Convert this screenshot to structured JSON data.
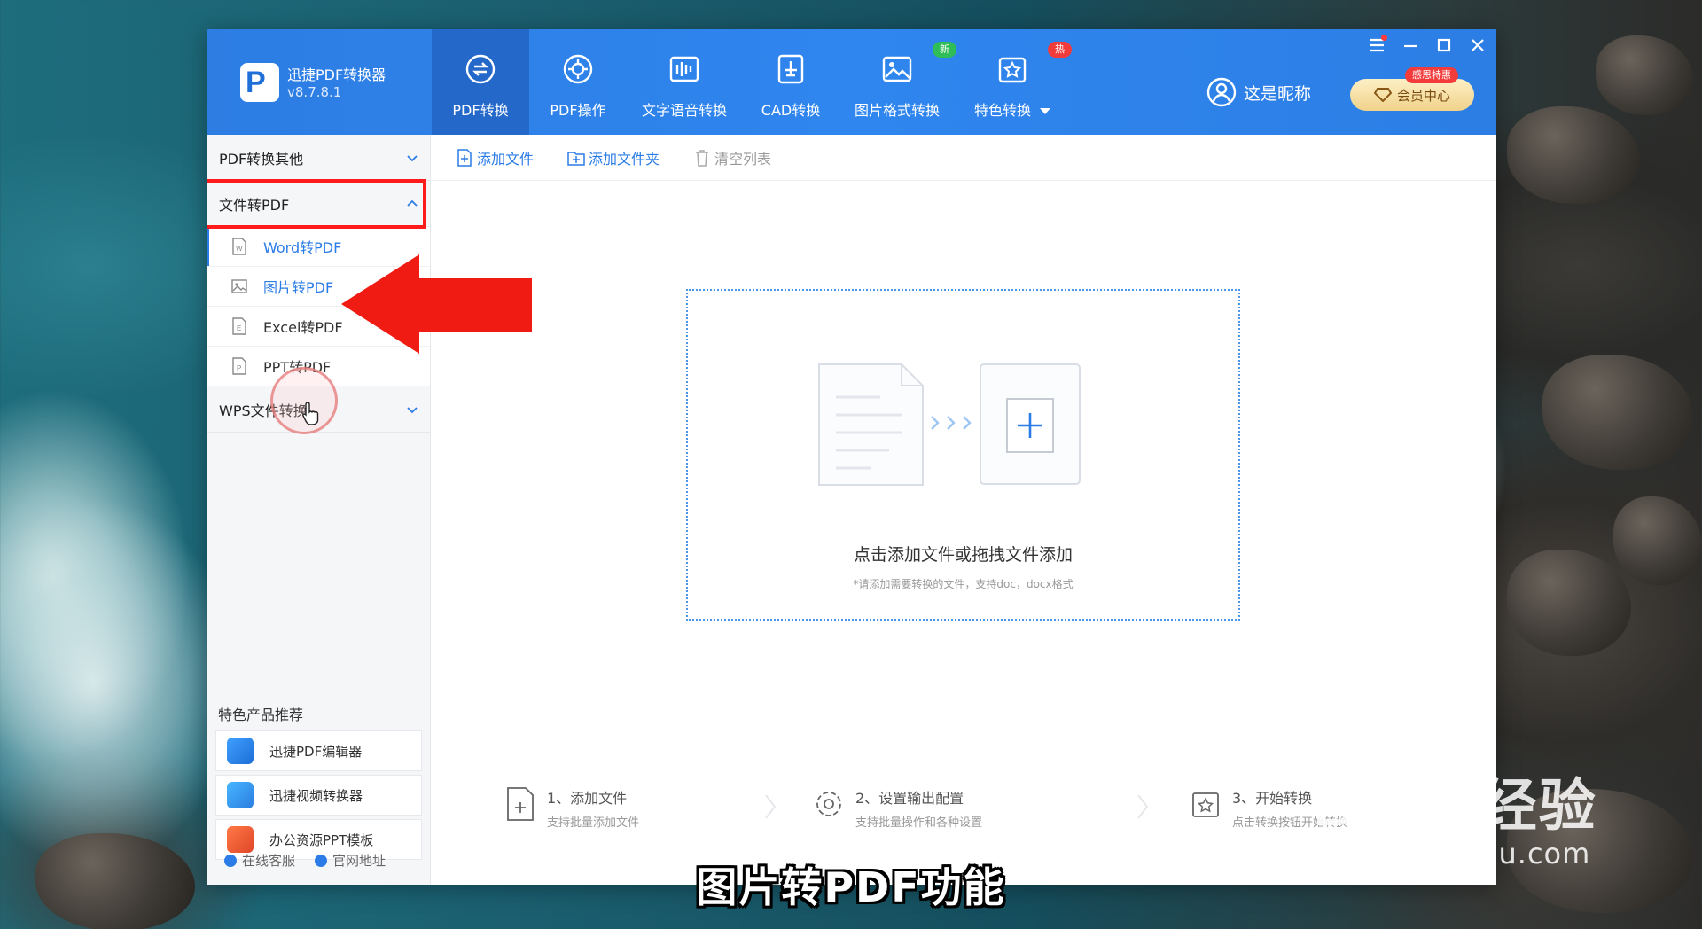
{
  "app": {
    "name": "迅捷PDF转换器",
    "version": "v8.7.8.1"
  },
  "topnav": [
    {
      "label": "PDF转换",
      "icon": "pdf-convert-icon",
      "active": true
    },
    {
      "label": "PDF操作",
      "icon": "pdf-operate-icon"
    },
    {
      "label": "文字语音转换",
      "icon": "audio-wave-icon"
    },
    {
      "label": "CAD转换",
      "icon": "cad-icon"
    },
    {
      "label": "图片格式转换",
      "icon": "image-icon",
      "badge": "新"
    },
    {
      "label": "特色转换",
      "icon": "star-convert-icon",
      "badge": "热"
    }
  ],
  "user": {
    "nickname": "这是昵称",
    "vip_label": "会员中心",
    "vip_tag": "感恩特惠"
  },
  "sidebar": {
    "groups": [
      {
        "label": "PDF转换其他"
      },
      {
        "label": "文件转PDF",
        "items": [
          "Word转PDF",
          "图片转PDF",
          "Excel转PDF",
          "PPT转PDF"
        ]
      },
      {
        "label": "WPS文件转换"
      }
    ],
    "featured_title": "特色产品推荐",
    "featured": [
      "迅捷PDF编辑器",
      "迅捷视频转换器",
      "办公资源PPT模板"
    ],
    "footer": [
      "在线客服",
      "官网地址"
    ]
  },
  "toolbar": {
    "add_file": "添加文件",
    "add_folder": "添加文件夹",
    "clear_list": "清空列表"
  },
  "dropzone": {
    "text": "点击添加文件或拖拽文件添加",
    "hint": "*请添加需要转换的文件，支持doc，docx格式"
  },
  "steps": [
    {
      "title": "1、添加文件",
      "desc": "支持批量添加文件"
    },
    {
      "title": "2、设置输出配置",
      "desc": "支持批量操作和各种设置"
    },
    {
      "title": "3、开始转换",
      "desc": "点击转换按钮开始转换"
    }
  ],
  "subtitle": "图片转PDF功能",
  "watermark": {
    "main": "Baidu经验",
    "url": "jingyan.baidu.com"
  },
  "colors": {
    "primary": "#2f86ee",
    "accent_red": "#ff1b1b"
  }
}
